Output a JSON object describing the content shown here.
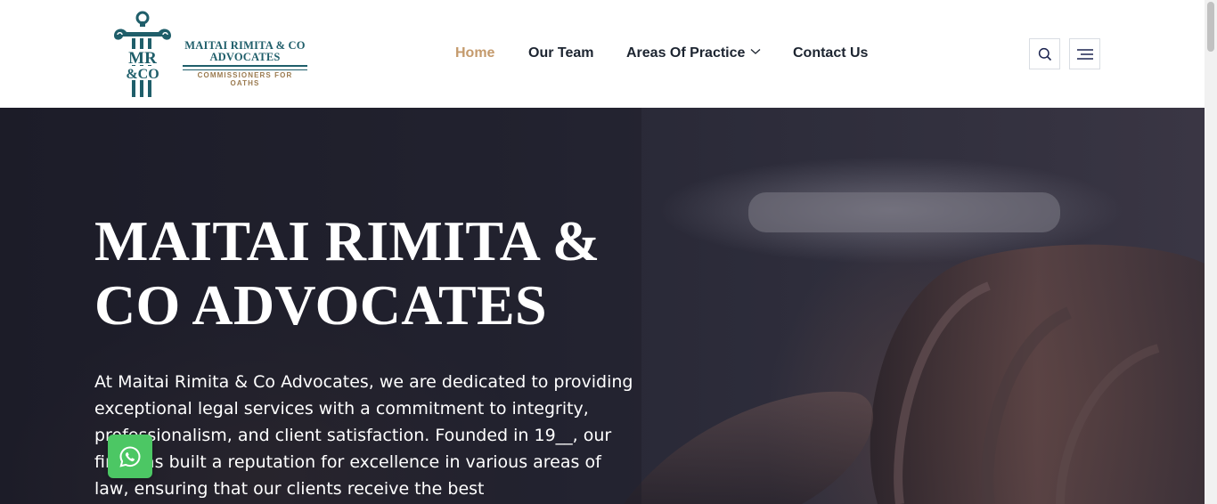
{
  "logo": {
    "monogram_top": "MR",
    "monogram_bottom": "&CO",
    "name_line1": "MAITAI RIMITA & CO",
    "name_line2": "ADVOCATES",
    "tagline": "COMMISSIONERS FOR OATHS",
    "brand_color": "#1f5e6a",
    "accent_color": "#9a7a4f"
  },
  "nav": {
    "items": [
      {
        "label": "Home",
        "active": true
      },
      {
        "label": "Our Team",
        "active": false
      },
      {
        "label": "Areas Of Practice",
        "active": false,
        "has_dropdown": true
      },
      {
        "label": "Contact Us",
        "active": false
      }
    ],
    "active_color": "#c49a6c",
    "search_icon": "search-icon",
    "menu_icon": "hamburger-menu-icon"
  },
  "hero": {
    "title": "MAITAI RIMITA & CO ADVOCATES",
    "text": "At Maitai Rimita & Co Advocates, we are dedicated to providing exceptional legal services with a commitment to integrity, professionalism, and client satisfaction. Founded in 19__, our firm has built a reputation for excellence in various areas of law, ensuring that our clients receive the best"
  },
  "whatsapp": {
    "icon": "whatsapp-icon",
    "color": "#4cc764"
  }
}
